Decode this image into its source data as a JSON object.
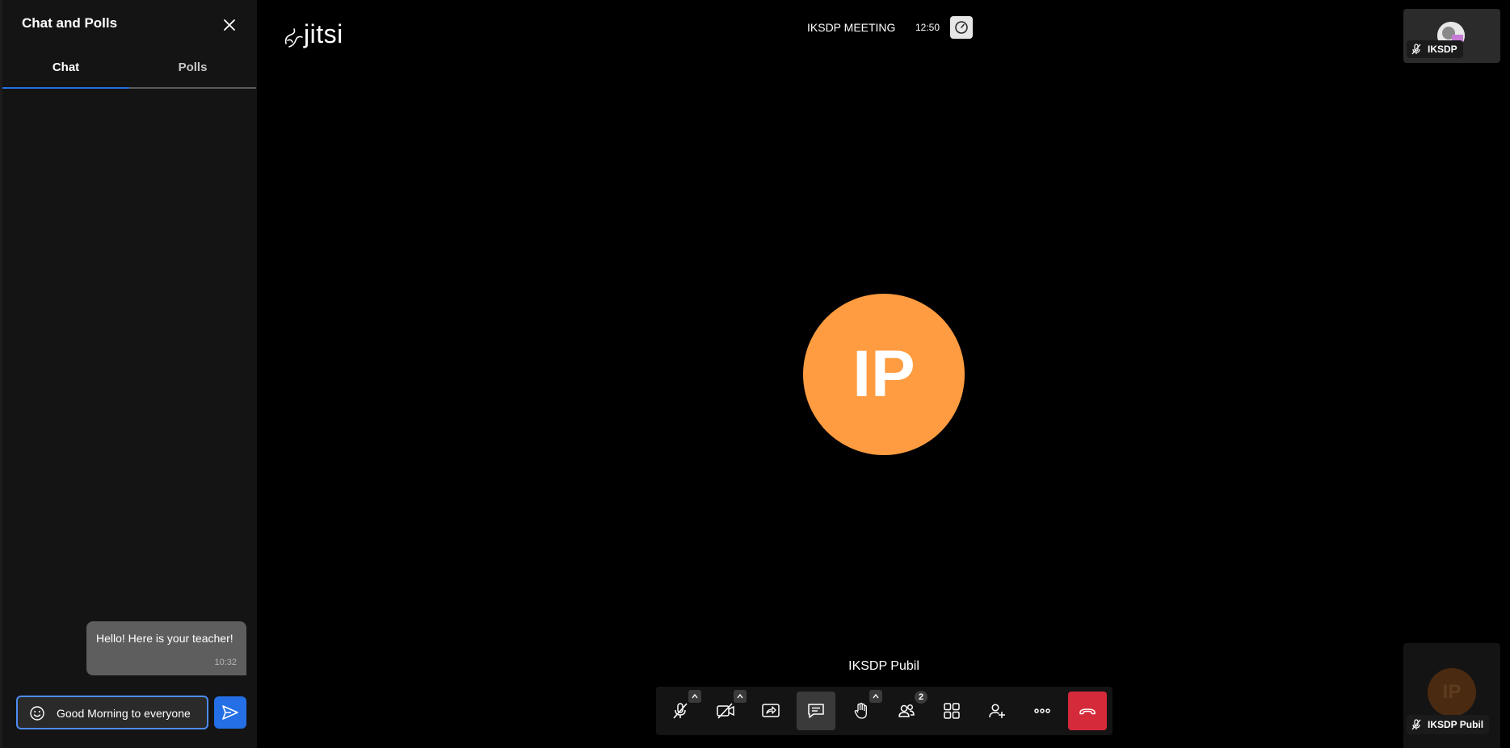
{
  "chat": {
    "title": "Chat and Polls",
    "tabs": [
      {
        "label": "Chat",
        "selected": true
      },
      {
        "label": "Polls",
        "selected": false
      }
    ],
    "messages": [
      {
        "text": "Hello! Here is your teacher!",
        "time": "10:32"
      }
    ],
    "input": {
      "value": "Good Morning to everyone"
    },
    "icons": {
      "close": "close-icon",
      "emoji": "emoji-icon",
      "send": "send-icon"
    }
  },
  "header": {
    "logo_text": "jitsi",
    "meeting_title": "IKSDP MEETING",
    "time": "12:50",
    "performance_icon": "speedometer-icon"
  },
  "stage": {
    "main_avatar_initials": "IP",
    "main_avatar_color": "#ff9c41",
    "speaker_name": "IKSDP Pubil"
  },
  "thumbnails": [
    {
      "name": "IKSDP",
      "mic_muted": true
    },
    {
      "name": "IKSDP Pubil",
      "initials": "IP",
      "mic_muted": true
    }
  ],
  "toolbar": {
    "participants_count": "2",
    "buttons": [
      "microphone",
      "camera",
      "share-screen",
      "chat",
      "raise-hand",
      "participants",
      "tile-view",
      "invite",
      "more",
      "hangup"
    ]
  },
  "colors": {
    "accent": "#246fe5",
    "hangup": "#d42a3a",
    "panel_bg": "#141414"
  }
}
